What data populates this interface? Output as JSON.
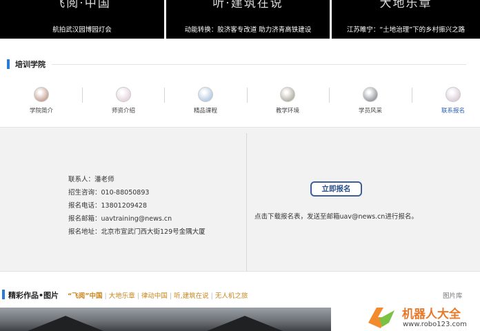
{
  "banners": [
    {
      "headline": "飞阅·中国",
      "caption": "航拍武汉园博园灯会"
    },
    {
      "headline": "听·建筑在说",
      "caption": "动能转换：胶济客专改道 助力济青高铁建设"
    },
    {
      "headline": "大地乐章",
      "caption": "江苏睢宁：“土地治理”下的乡村振兴之路"
    }
  ],
  "academy": {
    "title": "培训学院",
    "tabs": [
      {
        "label": "学院简介",
        "icon": "building-icon",
        "color": "#c9a79a"
      },
      {
        "label": "师资介绍",
        "icon": "teachers-icon",
        "color": "#e6d6df"
      },
      {
        "label": "精品课程",
        "icon": "course-icon",
        "color": "#b9cde2"
      },
      {
        "label": "教学环境",
        "icon": "classroom-icon",
        "color": "#b7b4a8"
      },
      {
        "label": "学员风采",
        "icon": "students-icon",
        "color": "#9a9ea3"
      },
      {
        "label": "联系报名",
        "icon": "contact-icon",
        "color": "#ddd0da"
      }
    ],
    "active_tab": "联系报名"
  },
  "contact": {
    "person": "联系人：潘老师",
    "consult": "招生咨询：010-88050893",
    "phone": "报名电话：13801209428",
    "email": "报名邮箱：uavtraining@news.cn",
    "address": "报名地址：北京市宣武门西大街129号金隅大厦",
    "apply_button": "立即报名",
    "apply_note": "点击下载报名表，发送至邮箱uav@news.cn进行报名。"
  },
  "works": {
    "title": "精彩作品•图片",
    "categories": [
      "“飞阅”中国",
      "大地乐章",
      "律动中国",
      "听,建筑在说",
      "无人机之旅"
    ],
    "library_link": "图片库"
  },
  "logo": {
    "name": "机器人大全",
    "url": "www.robo123.com"
  }
}
